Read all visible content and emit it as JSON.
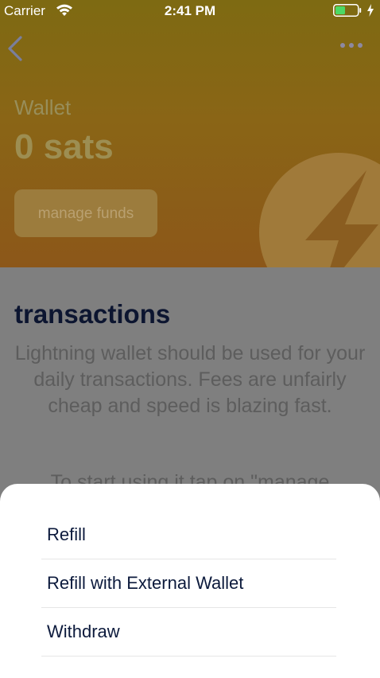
{
  "status_bar": {
    "carrier": "Carrier",
    "time": "2:41 PM"
  },
  "wallet": {
    "label": "Wallet",
    "balance": "0 sats",
    "manage_funds": "manage funds"
  },
  "transactions": {
    "title": "transactions",
    "description": "Lightning wallet should be used for your daily transactions. Fees are unfairly cheap and speed is blazing fast.",
    "hint": "To start using it tap on \"manage"
  },
  "action_sheet": {
    "items": [
      {
        "label": "Refill"
      },
      {
        "label": "Refill with External Wallet"
      },
      {
        "label": "Withdraw"
      }
    ]
  },
  "colors": {
    "header_gradient_start": "#7e6a12",
    "header_gradient_end": "#8c5719",
    "overlay": "#7f7f7f",
    "sheet_background": "#ffffff",
    "sheet_text": "#0c1a3c",
    "battery_fill": "#4cd964"
  },
  "icons": {
    "back": "chevron-left-icon",
    "more": "more-dots-icon",
    "wifi": "wifi-icon",
    "battery": "battery-icon",
    "charging": "charging-bolt-icon",
    "wallet_logo": "lightning-bolt-icon"
  }
}
